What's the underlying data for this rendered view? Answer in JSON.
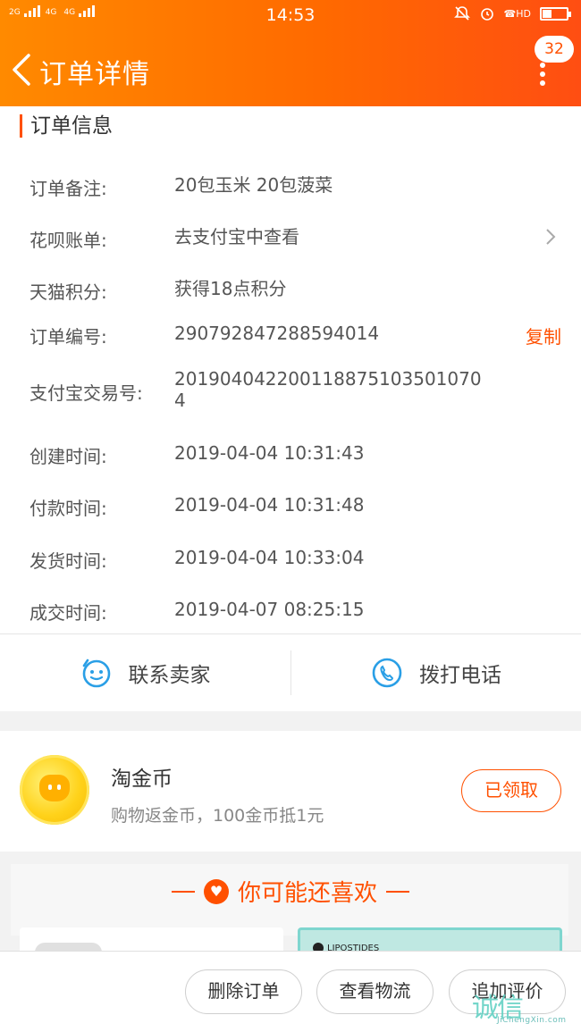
{
  "status_bar": {
    "signal_1": "2G",
    "signal_2": "4G",
    "signal_3": "4G",
    "time": "14:53",
    "hd": "HD"
  },
  "nav": {
    "title": "订单详情",
    "badge_count": "32"
  },
  "order_info": {
    "section_title": "订单信息",
    "rows": [
      {
        "label": "订单备注:",
        "value": "20包玉米 20包菠菜"
      },
      {
        "label": "花呗账单:",
        "value": "去支付宝中查看"
      },
      {
        "label": "天猫积分:",
        "value": "获得18点积分"
      },
      {
        "label": "订单编号:",
        "value": "290792847288594014",
        "action": "复制"
      },
      {
        "label": "支付宝交易号:",
        "value": "2019040422001188751035010704"
      },
      {
        "label": "创建时间:",
        "value": "2019-04-04 10:31:43"
      },
      {
        "label": "付款时间:",
        "value": "2019-04-04 10:31:48"
      },
      {
        "label": "发货时间:",
        "value": "2019-04-04 10:33:04"
      },
      {
        "label": "成交时间:",
        "value": "2019-04-07 08:25:15"
      }
    ]
  },
  "contact": {
    "seller_label": "联系卖家",
    "phone_label": "拨打电话"
  },
  "coin": {
    "title": "淘金币",
    "subtitle": "购物返金币，100金币抵1元",
    "button_label": "已领取"
  },
  "recommend": {
    "title": "你可能还喜欢",
    "brand_text": "LIPOSTIDES"
  },
  "bottom_actions": {
    "delete_label": "删除订单",
    "logistics_label": "查看物流",
    "review_label": "追加评价"
  },
  "watermark": {
    "logo": "诚信",
    "url": "JiChengXin.com"
  },
  "colors": {
    "accent": "#ff5000",
    "header_start": "#ff8a00",
    "header_end": "#ff4e12",
    "contact_icon": "#2a9fe6"
  },
  "icons": {
    "back": "chevron-left-icon",
    "more": "more-vertical-icon",
    "chat": "chat-smile-icon",
    "phone": "phone-icon",
    "coin": "coin-icon",
    "heart": "heart-icon",
    "chevron": "chevron-right-icon"
  }
}
